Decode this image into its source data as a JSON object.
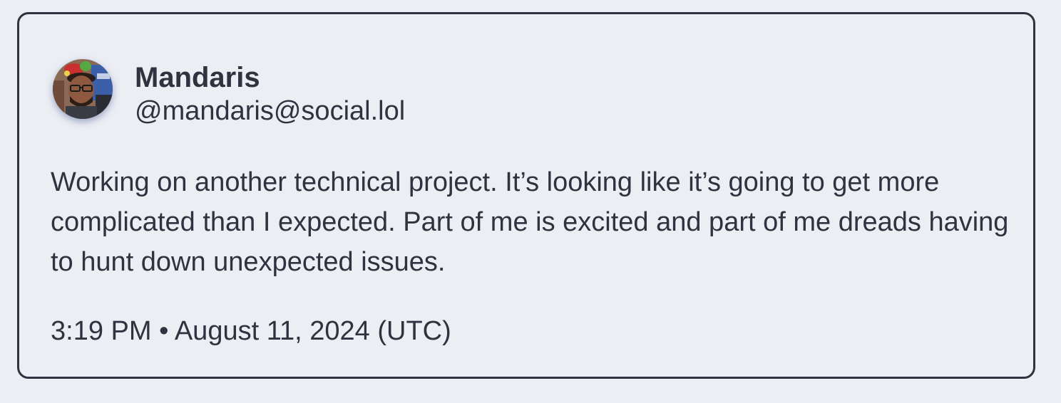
{
  "post": {
    "author": {
      "display_name": "Mandaris",
      "handle": "@mandaris@social.lol",
      "avatar_icon": "user-avatar-photo"
    },
    "content": "Working on another technical project. It’s looking like it’s going to get more complicated than I expected. Part of me is excited and part of me dreads having to hunt down unexpected issues.",
    "timestamp": "3:19 PM • August 11, 2024 (UTC)"
  },
  "colors": {
    "background": "#eceef4",
    "text": "#2f3340",
    "border": "#2f3340"
  }
}
